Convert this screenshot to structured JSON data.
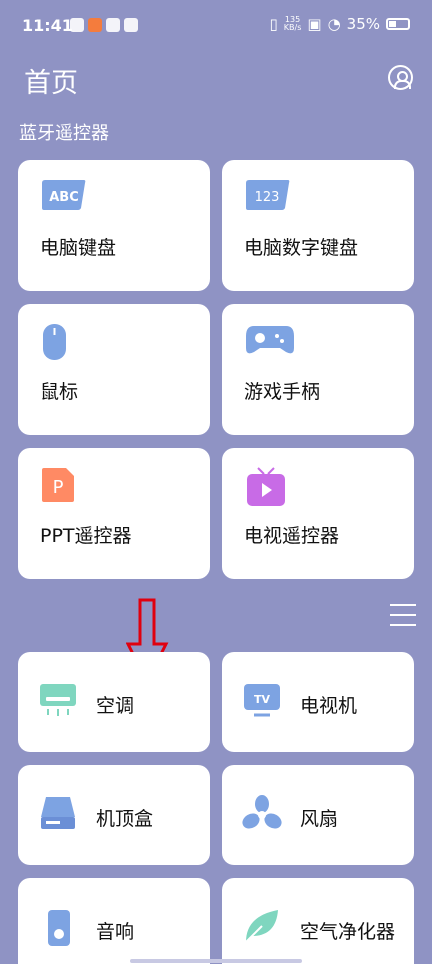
{
  "status_bar": {
    "time": "11:41",
    "speed_value": "135",
    "speed_unit": "KB/s",
    "battery": "35%",
    "app_icons": [
      "leaf-app-icon",
      "orange-app-icon",
      "mail-app-icon",
      "play-app-icon"
    ]
  },
  "header": {
    "title": "首页",
    "profile_icon": "person-icon"
  },
  "bluetooth_section": {
    "label": "蓝牙遥控器",
    "cards": [
      {
        "label": "电脑键盘",
        "icon": "abc-keyboard-icon"
      },
      {
        "label": "电脑数字键盘",
        "icon": "numeric-keyboard-icon"
      },
      {
        "label": "鼠标",
        "icon": "mouse-icon"
      },
      {
        "label": "游戏手柄",
        "icon": "gamepad-icon"
      },
      {
        "label": "PPT遥控器",
        "icon": "ppt-icon"
      },
      {
        "label": "电视遥控器",
        "icon": "tv-remote-icon"
      }
    ]
  },
  "appliance_section": {
    "menu_icon": "menu-icon",
    "arrow_icon": "red-down-arrow-icon",
    "cards": [
      {
        "label": "空调",
        "icon": "air-conditioner-icon"
      },
      {
        "label": "电视机",
        "icon": "tv-icon"
      },
      {
        "label": "机顶盒",
        "icon": "set-top-box-icon"
      },
      {
        "label": "风扇",
        "icon": "fan-icon"
      },
      {
        "label": "音响",
        "icon": "speaker-icon"
      },
      {
        "label": "空气净化器",
        "icon": "air-purifier-icon"
      }
    ]
  },
  "colors": {
    "background": "#8f93c4",
    "card": "#ffffff",
    "arrow": "#e0000f",
    "icon_blue": "#7da3e2",
    "icon_green": "#7fd6bf",
    "icon_orange": "#ff8a64",
    "icon_purple": "#c86be6"
  }
}
